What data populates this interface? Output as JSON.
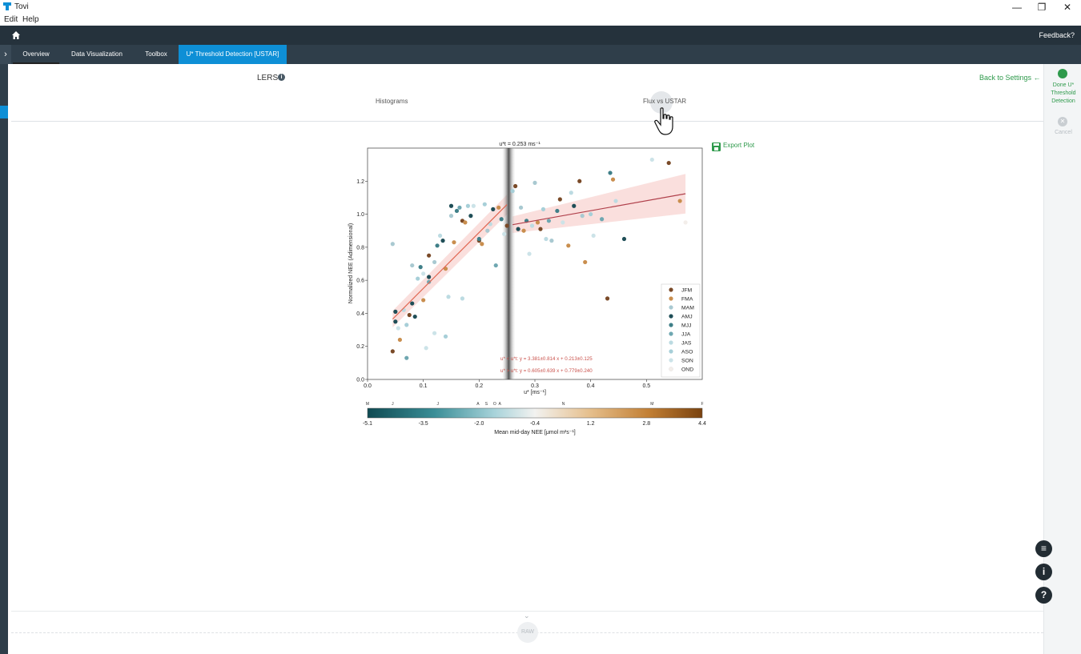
{
  "window": {
    "title": "Tovi",
    "min": "—",
    "max": "❐",
    "close": "✕"
  },
  "menu": {
    "edit": "Edit",
    "help": "Help"
  },
  "topbar": {
    "feedback": "Feedback?"
  },
  "tabs": [
    {
      "label": "Overview"
    },
    {
      "label": "Data Visualization"
    },
    {
      "label": "Toolbox"
    },
    {
      "label": "U* Threshold Detection [USTAR]"
    }
  ],
  "page": {
    "site": "LERS",
    "subtabs": {
      "histograms": "Histograms",
      "flux_vs_ustar": "Flux vs USTAR"
    },
    "back_to_settings": "Back to Settings ←",
    "export_plot": "Export Plot",
    "raw": "RAW"
  },
  "right_panel": {
    "done": "Done U* Threshold Detection",
    "cancel": "Cancel"
  },
  "colors": {
    "accent": "#0e8fd6",
    "green": "#2f9a4c",
    "fit_line": "#c9504a",
    "dark": "#25323c"
  },
  "chart_data": {
    "type": "scatter",
    "title": "u*t = 0.253 ms⁻¹",
    "xlabel": "u* [ms⁻¹]",
    "ylabel": "Normalized NEE (Adimensional)",
    "xlim": [
      0.0,
      0.6
    ],
    "ylim": [
      0.0,
      1.4
    ],
    "xticks": [
      "0.0",
      "0.1",
      "0.2",
      "0.3",
      "0.4",
      "0.5"
    ],
    "yticks": [
      "0.0",
      "0.2",
      "0.4",
      "0.6",
      "0.8",
      "1.0",
      "1.2"
    ],
    "threshold": 0.253,
    "fit_below": {
      "label": "u* < u*t: y = 3.381±0.814 x + 0.213±0.125",
      "x": [
        0.045,
        0.25
      ],
      "slope": 3.381,
      "intercept": 0.213
    },
    "fit_above": {
      "label": "u* > u*t: y = 0.605±0.639 x + 0.779±0.240",
      "x": [
        0.26,
        0.57
      ],
      "slope": 0.605,
      "intercept": 0.779
    },
    "legend": [
      "JFM",
      "FMA",
      "MAM",
      "AMJ",
      "MJJ",
      "JJA",
      "JAS",
      "ASO",
      "SON",
      "OND"
    ],
    "legend_colors": [
      "#7a4a28",
      "#c98e4e",
      "#a9c9d1",
      "#1f4e57",
      "#3f7f88",
      "#6fa7b1",
      "#bcdbe2",
      "#a7cfd8",
      "#cce3e8",
      "#f3eeea"
    ],
    "points": [
      [
        0.045,
        0.82,
        2
      ],
      [
        0.045,
        0.17,
        0
      ],
      [
        0.05,
        0.35,
        3
      ],
      [
        0.05,
        0.41,
        3
      ],
      [
        0.055,
        0.31,
        8
      ],
      [
        0.058,
        0.24,
        1
      ],
      [
        0.065,
        0.42,
        6
      ],
      [
        0.07,
        0.33,
        7
      ],
      [
        0.07,
        0.13,
        5
      ],
      [
        0.075,
        0.39,
        0
      ],
      [
        0.08,
        0.46,
        3
      ],
      [
        0.08,
        0.69,
        2
      ],
      [
        0.085,
        0.38,
        3
      ],
      [
        0.09,
        0.61,
        7
      ],
      [
        0.095,
        0.68,
        4
      ],
      [
        0.1,
        0.64,
        8
      ],
      [
        0.1,
        0.48,
        1
      ],
      [
        0.105,
        0.19,
        8
      ],
      [
        0.11,
        0.75,
        0
      ],
      [
        0.11,
        0.62,
        3
      ],
      [
        0.11,
        0.59,
        5
      ],
      [
        0.12,
        0.71,
        2
      ],
      [
        0.12,
        0.28,
        8
      ],
      [
        0.125,
        0.81,
        4
      ],
      [
        0.13,
        0.87,
        6
      ],
      [
        0.135,
        0.84,
        3
      ],
      [
        0.14,
        0.67,
        1
      ],
      [
        0.14,
        0.26,
        7
      ],
      [
        0.145,
        0.5,
        6
      ],
      [
        0.15,
        0.99,
        2
      ],
      [
        0.15,
        1.05,
        3
      ],
      [
        0.155,
        0.83,
        1
      ],
      [
        0.16,
        1.02,
        4
      ],
      [
        0.165,
        1.04,
        5
      ],
      [
        0.17,
        0.96,
        0
      ],
      [
        0.17,
        0.49,
        6
      ],
      [
        0.175,
        0.95,
        1
      ],
      [
        0.18,
        1.05,
        7
      ],
      [
        0.185,
        0.99,
        3
      ],
      [
        0.19,
        1.05,
        8
      ],
      [
        0.2,
        0.84,
        0
      ],
      [
        0.2,
        0.85,
        4
      ],
      [
        0.205,
        0.82,
        1
      ],
      [
        0.21,
        1.06,
        7
      ],
      [
        0.215,
        0.9,
        2
      ],
      [
        0.22,
        0.94,
        6
      ],
      [
        0.225,
        1.03,
        3
      ],
      [
        0.23,
        0.69,
        5
      ],
      [
        0.235,
        1.04,
        1
      ],
      [
        0.24,
        0.97,
        4
      ],
      [
        0.245,
        0.88,
        8
      ],
      [
        0.25,
        0.93,
        0
      ],
      [
        0.26,
        1.14,
        7
      ],
      [
        0.265,
        1.17,
        0
      ],
      [
        0.27,
        0.91,
        3
      ],
      [
        0.275,
        1.04,
        2
      ],
      [
        0.28,
        0.9,
        1
      ],
      [
        0.285,
        0.96,
        4
      ],
      [
        0.29,
        0.76,
        8
      ],
      [
        0.295,
        0.93,
        6
      ],
      [
        0.3,
        1.19,
        2
      ],
      [
        0.305,
        0.95,
        1
      ],
      [
        0.31,
        0.91,
        0
      ],
      [
        0.315,
        1.03,
        7
      ],
      [
        0.32,
        0.85,
        6
      ],
      [
        0.325,
        0.96,
        5
      ],
      [
        0.33,
        0.84,
        2
      ],
      [
        0.34,
        1.02,
        4
      ],
      [
        0.345,
        1.09,
        0
      ],
      [
        0.35,
        0.95,
        8
      ],
      [
        0.36,
        0.81,
        1
      ],
      [
        0.365,
        1.13,
        6
      ],
      [
        0.37,
        1.05,
        3
      ],
      [
        0.38,
        1.2,
        0
      ],
      [
        0.385,
        0.99,
        2
      ],
      [
        0.39,
        0.71,
        1
      ],
      [
        0.4,
        1.0,
        7
      ],
      [
        0.405,
        0.87,
        8
      ],
      [
        0.42,
        0.97,
        5
      ],
      [
        0.43,
        0.49,
        0
      ],
      [
        0.435,
        1.25,
        4
      ],
      [
        0.44,
        1.21,
        1
      ],
      [
        0.445,
        1.08,
        6
      ],
      [
        0.46,
        0.85,
        3
      ],
      [
        0.51,
        1.33,
        8
      ],
      [
        0.54,
        1.31,
        0
      ],
      [
        0.56,
        1.08,
        1
      ],
      [
        0.57,
        0.95,
        9
      ]
    ]
  },
  "colorbar": {
    "label": "Mean mid-day NEE [μmol m²s⁻¹]",
    "ticks": [
      "-5.1",
      "-3.5",
      "-2.0",
      "-0.4",
      "1.2",
      "2.8",
      "4.4"
    ],
    "months": [
      "M",
      "J",
      "J",
      "A",
      "S",
      "O",
      "A",
      "N",
      "M",
      "F"
    ]
  }
}
